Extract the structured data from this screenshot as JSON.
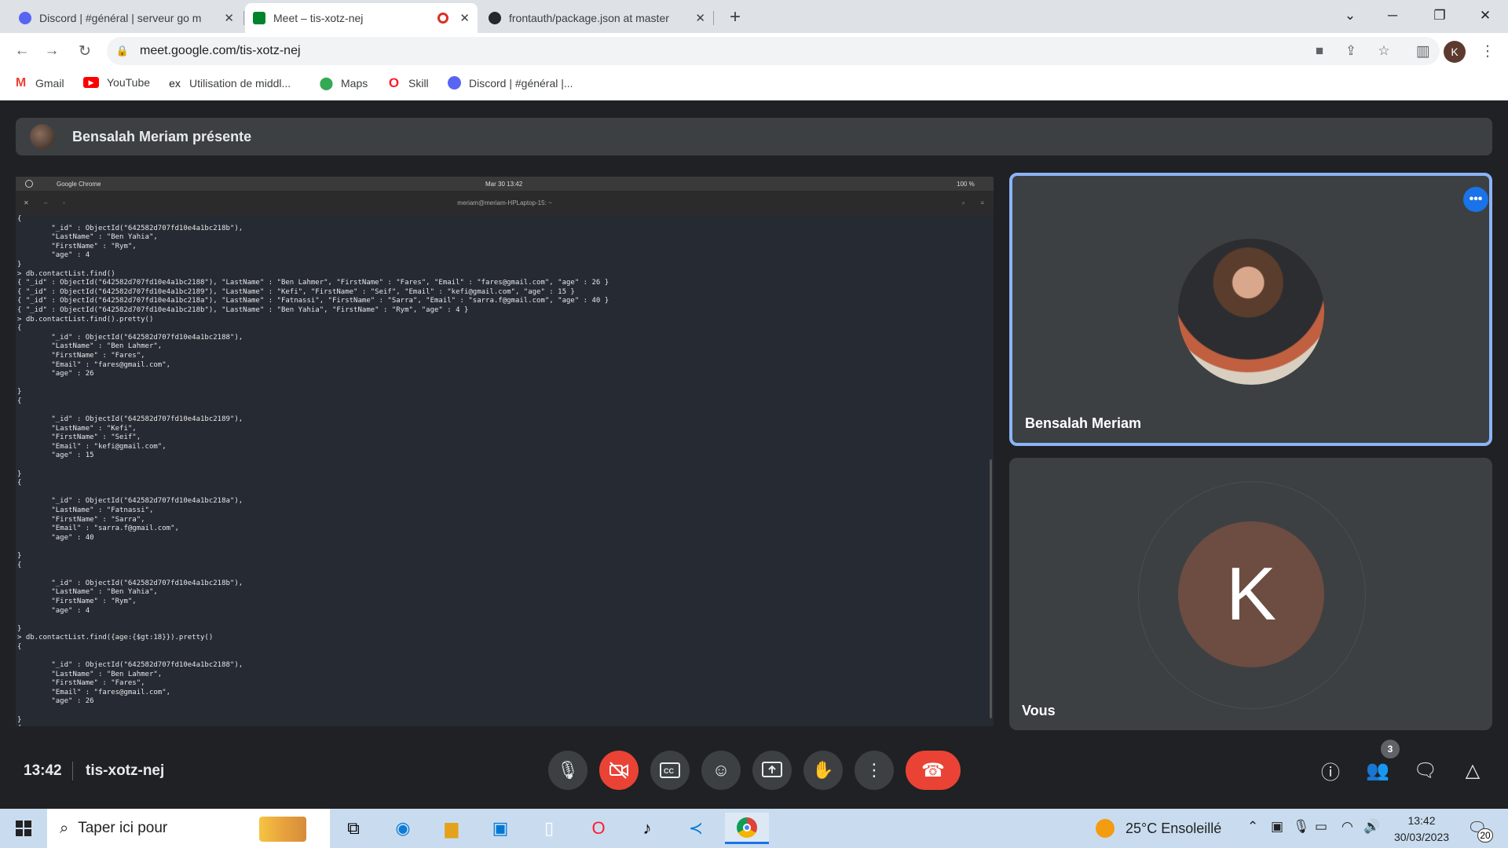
{
  "browser": {
    "tabs": [
      {
        "title": "Discord | #général | serveur go m",
        "icon": "discord-icon"
      },
      {
        "title": "Meet – tis-xotz-nej",
        "icon": "google-meet-icon"
      },
      {
        "title": "frontauth/package.json at master",
        "icon": "github-icon"
      }
    ],
    "new_tab_label": "+",
    "url": "meet.google.com/tis-xotz-nej",
    "profile_initial": "K",
    "bookmarks": [
      {
        "label": "Gmail",
        "icon": "gmail-icon"
      },
      {
        "label": "YouTube",
        "icon": "youtube-icon"
      },
      {
        "label": "Utilisation de middl...",
        "icon": "ex-icon"
      },
      {
        "label": "Maps",
        "icon": "maps-icon"
      },
      {
        "label": "Skill",
        "icon": "opera-icon"
      },
      {
        "label": "Discord | #général |...",
        "icon": "discord-icon"
      }
    ]
  },
  "meet": {
    "presenter_banner": "Bensalah Meriam présente",
    "shared_screen": {
      "topbar_app": "Google Chrome",
      "topbar_clock": "Mar 30  13:42",
      "topbar_battery": "100 %",
      "window_title": "meriam@meriam-HPLaptop-15: ~",
      "terminal_lines": [
        "{",
        "        \"_id\" : ObjectId(\"642582d707fd10e4a1bc218b\"),",
        "        \"LastName\" : \"Ben Yahia\",",
        "        \"FirstName\" : \"Rym\",",
        "        \"age\" : 4",
        "}",
        "> db.contactList.find()",
        "{ \"_id\" : ObjectId(\"642582d707fd10e4a1bc2188\"), \"LastName\" : \"Ben Lahmer\", \"FirstName\" : \"Fares\", \"Email\" : \"fares@gmail.com\", \"age\" : 26 }",
        "{ \"_id\" : ObjectId(\"642582d707fd10e4a1bc2189\"), \"LastName\" : \"Kefi\", \"FirstName\" : \"Seif\", \"Email\" : \"kefi@gmail.com\", \"age\" : 15 }",
        "{ \"_id\" : ObjectId(\"642582d707fd10e4a1bc218a\"), \"LastName\" : \"Fatnassi\", \"FirstName\" : \"Sarra\", \"Email\" : \"sarra.f@gmail.com\", \"age\" : 40 }",
        "{ \"_id\" : ObjectId(\"642582d707fd10e4a1bc218b\"), \"LastName\" : \"Ben Yahia\", \"FirstName\" : \"Rym\", \"age\" : 4 }",
        "> db.contactList.find().pretty()",
        "{",
        "        \"_id\" : ObjectId(\"642582d707fd10e4a1bc2188\"),",
        "        \"LastName\" : \"Ben Lahmer\",",
        "        \"FirstName\" : \"Fares\",",
        "        \"Email\" : \"fares@gmail.com\",",
        "        \"age\" : 26",
        "",
        "}",
        "{",
        "",
        "        \"_id\" : ObjectId(\"642582d707fd10e4a1bc2189\"),",
        "        \"LastName\" : \"Kefi\",",
        "        \"FirstName\" : \"Seif\",",
        "        \"Email\" : \"kefi@gmail.com\",",
        "        \"age\" : 15",
        "",
        "}",
        "{",
        "",
        "        \"_id\" : ObjectId(\"642582d707fd10e4a1bc218a\"),",
        "        \"LastName\" : \"Fatnassi\",",
        "        \"FirstName\" : \"Sarra\",",
        "        \"Email\" : \"sarra.f@gmail.com\",",
        "        \"age\" : 40",
        "",
        "}",
        "{",
        "",
        "        \"_id\" : ObjectId(\"642582d707fd10e4a1bc218b\"),",
        "        \"LastName\" : \"Ben Yahia\",",
        "        \"FirstName\" : \"Rym\",",
        "        \"age\" : 4",
        "",
        "}",
        "> db.contactList.find({age:{$gt:18}}).pretty()",
        "{",
        "",
        "        \"_id\" : ObjectId(\"642582d707fd10e4a1bc2188\"),",
        "        \"LastName\" : \"Ben Lahmer\",",
        "        \"FirstName\" : \"Fares\",",
        "        \"Email\" : \"fares@gmail.com\",",
        "        \"age\" : 26",
        "",
        "}",
        "{",
        "",
        "        \"_id\" : ObjectId(\"642582d707fd10e4a1bc218a\"),",
        "        \"LastName\" : \"Fatnassi\",",
        "        \"FirstName\" : \"Sarra\",",
        "        \"Email\" : \"sarra.f@gmail.com\",",
        "        \"age\" : 40",
        "",
        "}",
        "> ▯"
      ]
    },
    "participants": [
      {
        "name": "Bensalah Meriam",
        "has_photo": true,
        "active_speaker": true
      },
      {
        "name": "Vous",
        "initial": "K",
        "avatar_color": "#6d4c41"
      }
    ],
    "footer": {
      "time": "13:42",
      "meeting_code": "tis-xotz-nej",
      "participant_count": "3"
    },
    "controls": [
      {
        "name": "mic",
        "icon": "microphone-icon",
        "state": "on"
      },
      {
        "name": "camera",
        "icon": "camera-off-icon",
        "state": "off"
      },
      {
        "name": "captions",
        "icon": "captions-icon"
      },
      {
        "name": "reactions",
        "icon": "emoji-icon"
      },
      {
        "name": "present",
        "icon": "present-screen-icon"
      },
      {
        "name": "raise-hand",
        "icon": "hand-icon"
      },
      {
        "name": "more",
        "icon": "more-vert-icon"
      },
      {
        "name": "leave",
        "icon": "hang-up-icon"
      }
    ]
  },
  "taskbar": {
    "search_placeholder": "Taper ici pour",
    "weather": "25°C  Ensoleillé",
    "time": "13:42",
    "date": "30/03/2023",
    "notification_count": "20",
    "apps": [
      "task-view-icon",
      "edge-icon",
      "file-explorer-icon",
      "store-icon",
      "notepad-icon",
      "opera-icon",
      "tiktok-icon",
      "vscode-icon",
      "chrome-icon"
    ]
  },
  "colors": {
    "meet_bg": "#202124",
    "tile_bg": "#3c4043",
    "accent_blue": "#8ab4f8",
    "leave_red": "#ea4335"
  }
}
